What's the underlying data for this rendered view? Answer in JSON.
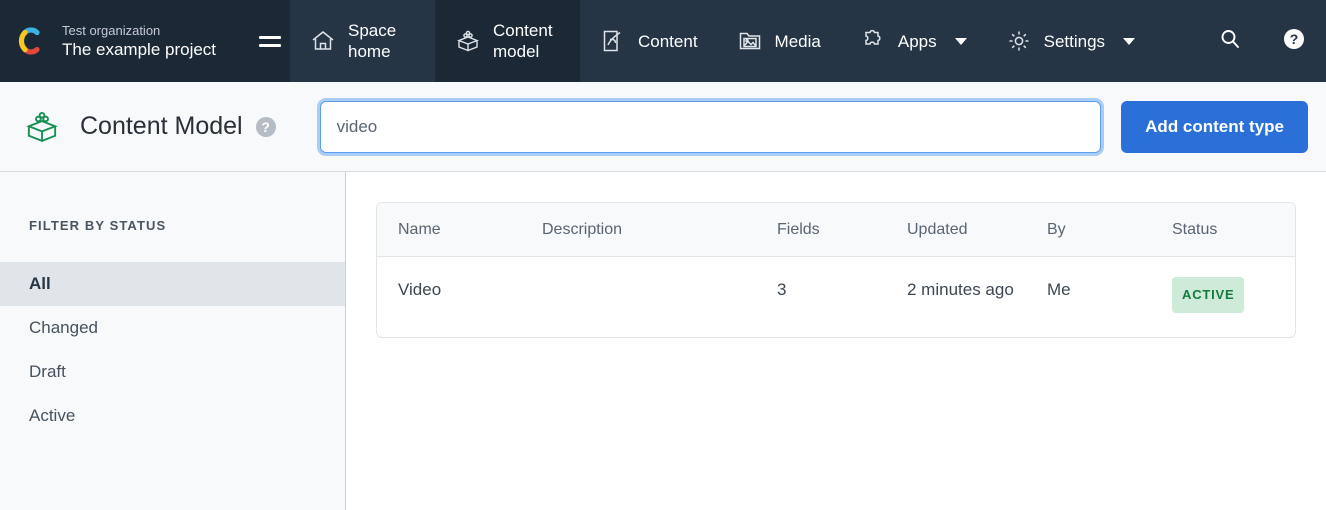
{
  "topnav": {
    "logo_icon": "contentful-logo",
    "organization": "Test organization",
    "project": "The example project",
    "menu_icon": "hamburger-menu-icon",
    "tabs": [
      {
        "label": "Space home",
        "icon": "home-icon",
        "active": false
      },
      {
        "label": "Content model",
        "icon": "content-model-icon",
        "active": true
      },
      {
        "label": "Content",
        "icon": "content-icon",
        "active": false
      },
      {
        "label": "Media",
        "icon": "media-icon",
        "active": false
      },
      {
        "label": "Apps",
        "icon": "apps-puzzle-icon",
        "active": false,
        "caret": true
      },
      {
        "label": "Settings",
        "icon": "settings-gear-icon",
        "active": false,
        "caret": true
      }
    ],
    "search_icon": "search-icon",
    "help_icon": "help-circle-icon"
  },
  "pageheader": {
    "icon": "content-model-icon",
    "title": "Content Model",
    "help_icon": "help-circle-icon",
    "search_value": "video",
    "search_placeholder": "",
    "add_button": "Add content type",
    "accent_color": "#2a70d8"
  },
  "sidebar": {
    "title": "FILTER BY STATUS",
    "items": [
      {
        "label": "All",
        "selected": true
      },
      {
        "label": "Changed",
        "selected": false
      },
      {
        "label": "Draft",
        "selected": false
      },
      {
        "label": "Active",
        "selected": false
      }
    ]
  },
  "table": {
    "columns": [
      "Name",
      "Description",
      "Fields",
      "Updated",
      "By",
      "Status"
    ],
    "rows": [
      {
        "name": "Video",
        "description": "",
        "fields": "3",
        "updated": "2 minutes ago",
        "by": "Me",
        "status": "ACTIVE",
        "status_bg": "#cdebd8",
        "status_fg": "#157a3d"
      }
    ]
  }
}
